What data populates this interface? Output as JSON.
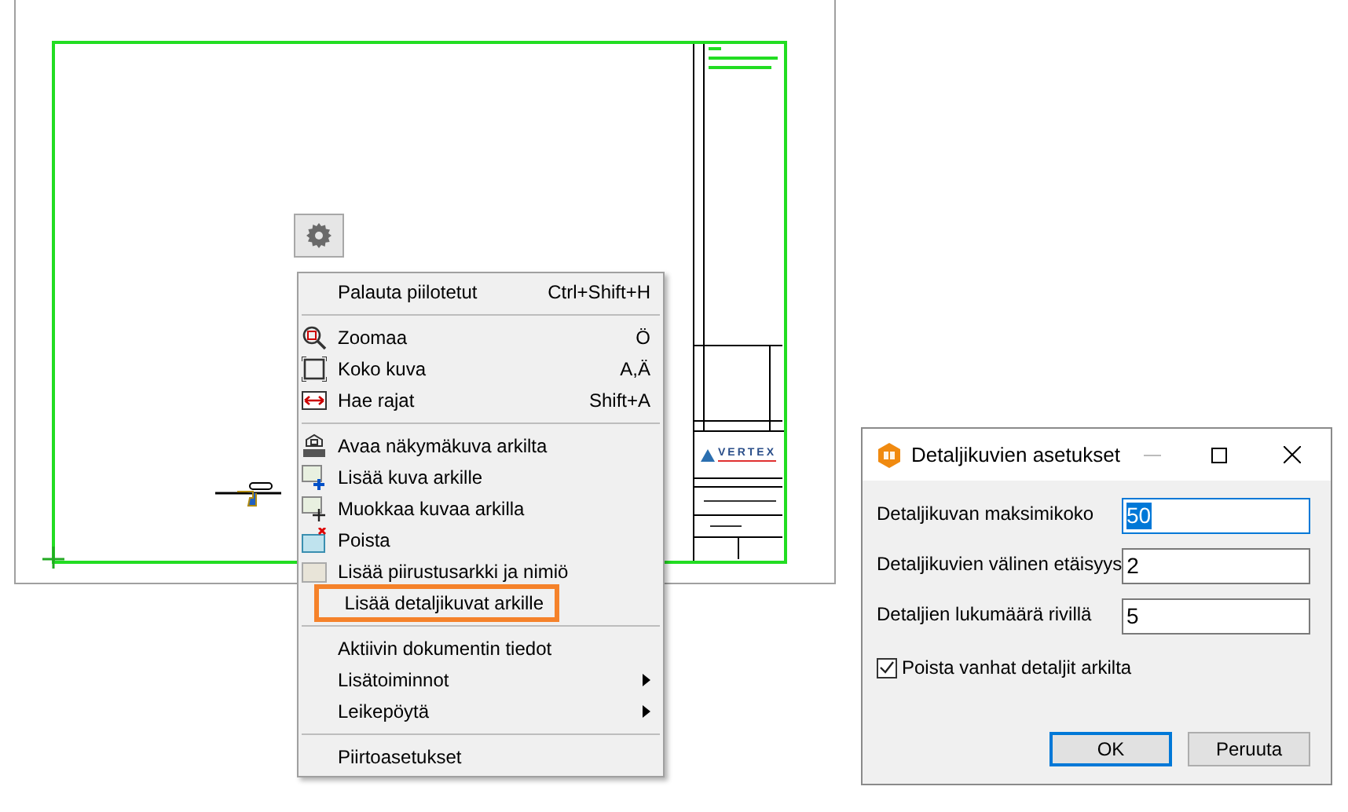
{
  "canvas": {
    "title_block": {
      "logo_text": "VERTEX"
    }
  },
  "context_menu": {
    "items": [
      {
        "kind": "item",
        "label": "Palauta piilotetut",
        "shortcut": "Ctrl+Shift+H",
        "highlighted": false
      },
      {
        "kind": "separator"
      },
      {
        "kind": "item",
        "label": "Zoomaa",
        "shortcut": "Ö",
        "highlighted": false
      },
      {
        "kind": "item",
        "label": "Koko kuva",
        "shortcut": "A,Ä",
        "highlighted": false
      },
      {
        "kind": "item",
        "label": "Hae rajat",
        "shortcut": "Shift+A",
        "highlighted": false
      },
      {
        "kind": "separator"
      },
      {
        "kind": "item",
        "label": "Avaa näkymäkuva arkilta",
        "highlighted": false
      },
      {
        "kind": "item",
        "label": "Lisää kuva arkille",
        "highlighted": false
      },
      {
        "kind": "item",
        "label": "Muokkaa kuvaa arkilla",
        "highlighted": false
      },
      {
        "kind": "item",
        "label": "Poista",
        "highlighted": false
      },
      {
        "kind": "item",
        "label": "Lisää piirustusarkki ja nimiö",
        "highlighted": false
      },
      {
        "kind": "item",
        "label": "Lisää detaljikuvat arkille",
        "highlighted": true
      },
      {
        "kind": "separator"
      },
      {
        "kind": "item",
        "label": "Aktiivin dokumentin tiedot",
        "highlighted": false
      },
      {
        "kind": "submenu",
        "label": "Lisätoiminnot",
        "highlighted": false
      },
      {
        "kind": "submenu",
        "label": "Leikepöytä",
        "highlighted": false
      },
      {
        "kind": "separator"
      },
      {
        "kind": "item",
        "label": "Piirtoasetukset",
        "highlighted": false
      }
    ]
  },
  "dialog": {
    "title": "Detaljikuvien asetukset",
    "fields": [
      {
        "label": "Detaljikuvan maksimikoko",
        "value": "50",
        "selected": true
      },
      {
        "label": "Detaljikuvien välinen etäisyys",
        "value": "2",
        "selected": false
      },
      {
        "label": "Detaljien lukumäärä rivillä",
        "value": "5",
        "selected": false
      }
    ],
    "checkbox": {
      "label": "Poista vanhat detaljit arkilta",
      "checked": true
    },
    "buttons": [
      {
        "label": "OK",
        "default": true
      },
      {
        "label": "Peruuta",
        "default": false
      }
    ]
  }
}
